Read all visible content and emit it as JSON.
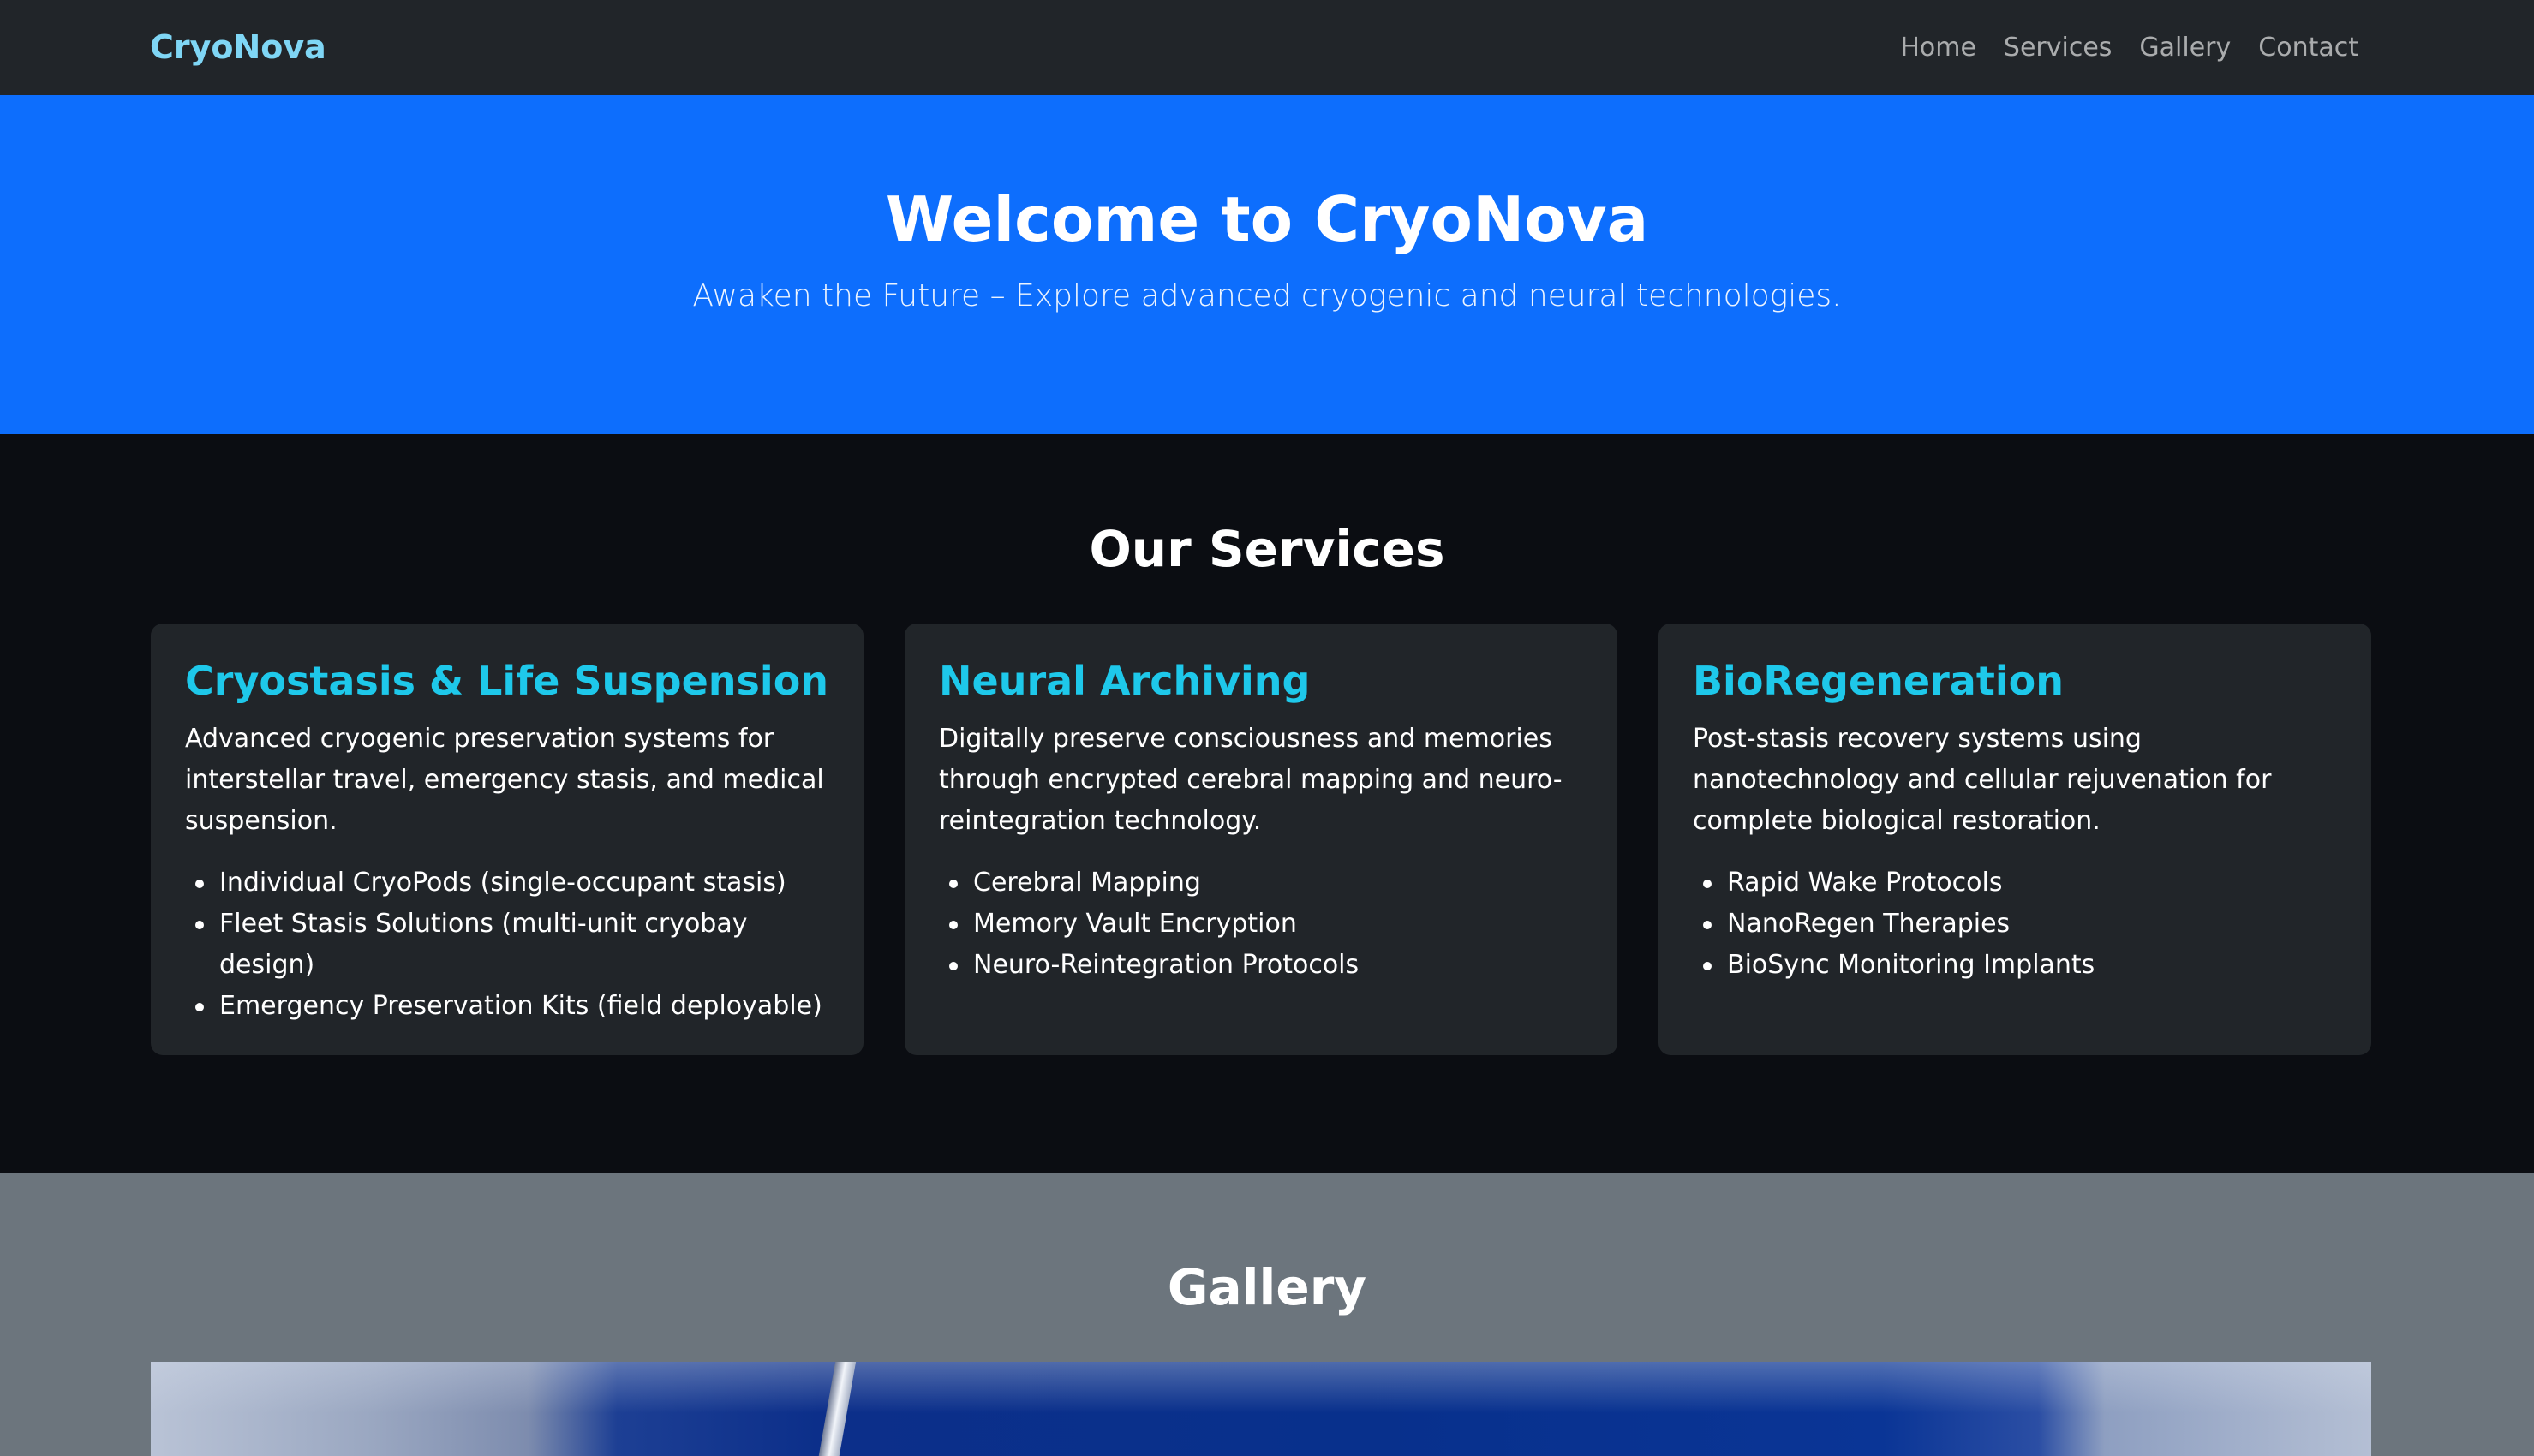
{
  "navbar": {
    "brand": "CryoNova",
    "links": [
      "Home",
      "Services",
      "Gallery",
      "Contact"
    ]
  },
  "hero": {
    "title": "Welcome to CryoNova",
    "subtitle": "Awaken the Future – Explore advanced cryogenic and neural technologies."
  },
  "services": {
    "title": "Our Services",
    "cards": [
      {
        "title": "Cryostasis & Life Suspension",
        "text": "Advanced cryogenic preservation systems for interstellar travel, emergency stasis, and medical suspension.",
        "items": [
          "Individual CryoPods (single-occupant stasis)",
          "Fleet Stasis Solutions (multi-unit cryobay design)",
          "Emergency Preservation Kits (field deployable)"
        ]
      },
      {
        "title": "Neural Archiving",
        "text": "Digitally preserve consciousness and memories through encrypted cerebral mapping and neuro-reintegration technology.",
        "items": [
          "Cerebral Mapping",
          "Memory Vault Encryption",
          "Neuro-Reintegration Protocols"
        ]
      },
      {
        "title": "BioRegeneration",
        "text": "Post-stasis recovery systems using nanotechnology and cellular rejuvenation for complete biological restoration.",
        "items": [
          "Rapid Wake Protocols",
          "NanoRegen Therapies",
          "BioSync Monitoring Implants"
        ]
      }
    ]
  },
  "gallery": {
    "title": "Gallery"
  },
  "colors": {
    "navbar_bg": "#212529",
    "brand": "#7fd6f5",
    "hero_bg": "#0d6efd",
    "services_bg": "#0b0d12",
    "card_bg": "#212529",
    "card_title": "#1ec8ea",
    "gallery_bg": "#6c757d"
  }
}
